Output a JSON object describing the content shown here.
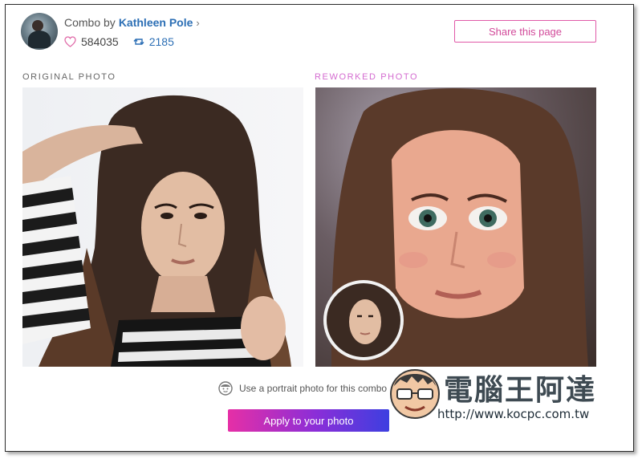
{
  "header": {
    "byline_prefix": "Combo by",
    "author": "Kathleen Pole",
    "likes": "584035",
    "remixes": "2185",
    "share_label": "Share this page"
  },
  "labels": {
    "original": "ORIGINAL PHOTO",
    "reworked": "REWORKED PHOTO"
  },
  "footer": {
    "hint": "Use a portrait photo for this combo",
    "apply_label": "Apply to your photo"
  },
  "watermark": {
    "title": "電腦王阿達",
    "url": "http://www.kocpc.com.tw"
  },
  "icons": {
    "likes": "heart-icon",
    "remix": "remix-icon",
    "author_link": "chevron-right-icon",
    "hint": "face-icon"
  },
  "colors": {
    "link_blue": "#2c6fb5",
    "accent_pink": "#d24a9a",
    "reworked_label": "#d46bd0",
    "apply_gradient_start": "#e62fa6",
    "apply_gradient_end": "#3d3fe0"
  }
}
